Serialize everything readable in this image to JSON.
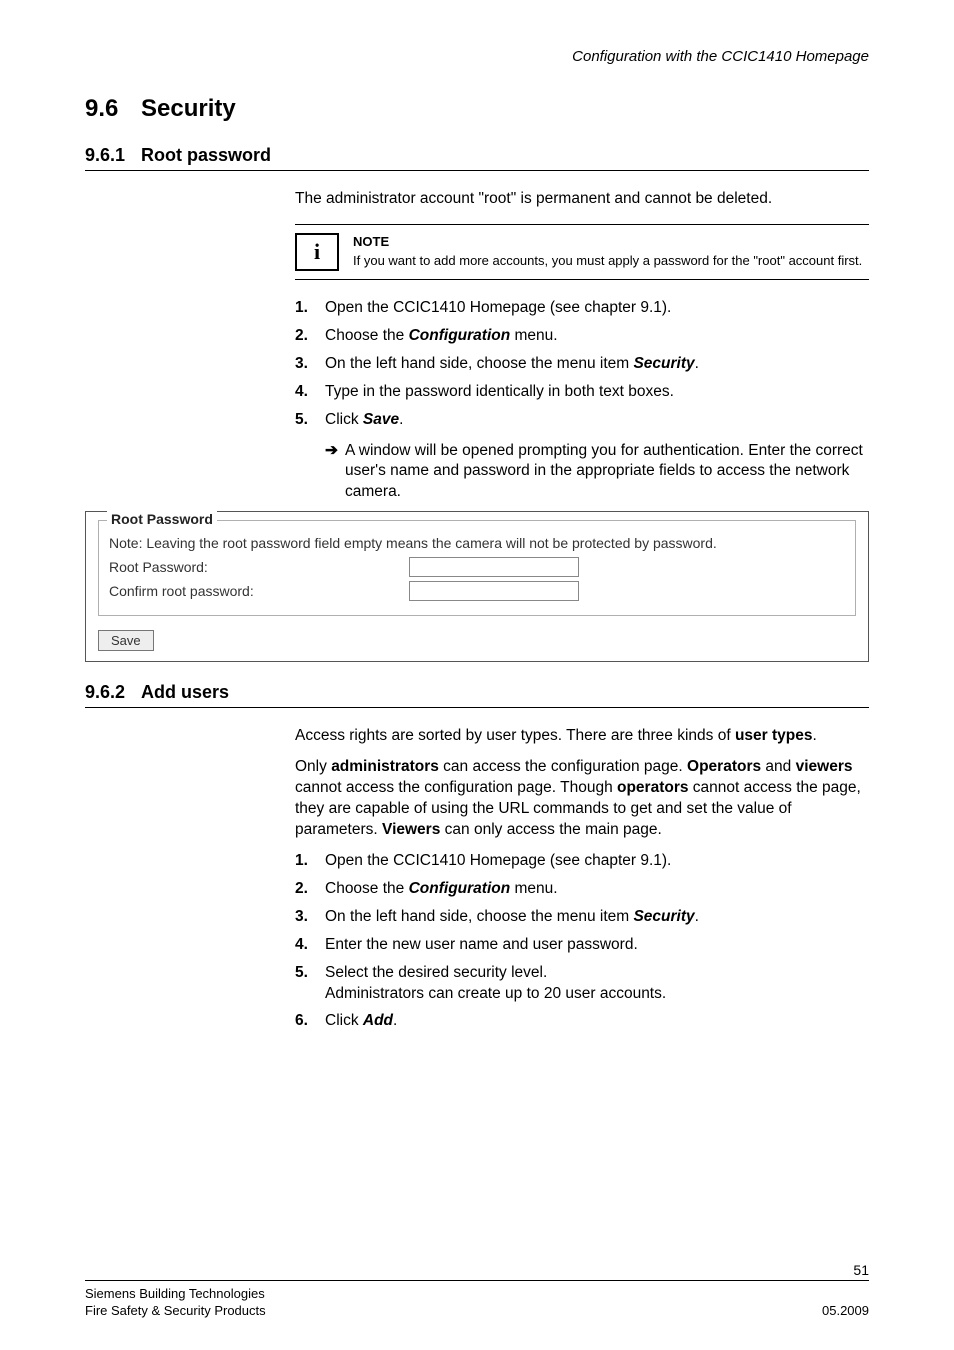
{
  "header": {
    "doc_section": "Configuration with the CCIC1410 Homepage"
  },
  "h1": {
    "num": "9.6",
    "title": "Security"
  },
  "section1": {
    "num": "9.6.1",
    "title": "Root password",
    "intro": "The administrator account \"root\" is permanent and cannot be deleted.",
    "note_title": "NOTE",
    "note_body": "If you want to add more accounts, you must apply a password for the \"root\" account first.",
    "steps": [
      {
        "n": "1.",
        "t": "Open the CCIC1410 Homepage (see chapter 9.1)."
      },
      {
        "n": "2.",
        "t_pre": "Choose the ",
        "t_em": "Configuration",
        "t_post": " menu."
      },
      {
        "n": "3.",
        "t_pre": "On the left hand side, choose the menu item ",
        "t_em": "Security",
        "t_post": "."
      },
      {
        "n": "4.",
        "t": "Type in the password identically in both text boxes."
      },
      {
        "n": "5.",
        "t_pre": "Click ",
        "t_em": "Save",
        "t_post": "."
      }
    ],
    "arrow": "A window will be opened prompting you for authentication. Enter the correct user's name and password in the appropriate fields to access the network camera.",
    "ui": {
      "legend": "Root Password",
      "note": "Note: Leaving the root password field empty means the camera will not be protected by password.",
      "label1": "Root Password:",
      "label2": "Confirm root password:",
      "save": "Save"
    }
  },
  "section2": {
    "num": "9.6.2",
    "title": "Add users",
    "para1_pre": "Access rights are sorted by user types. There are three kinds of ",
    "para1_b": "user types",
    "para1_post": ".",
    "para2_parts": {
      "a": "Only ",
      "b1": "administrators",
      "c": " can access the configuration page. ",
      "b2": "Operators",
      "d": " and ",
      "b3": "viewers",
      "e": " cannot access the configuration page. Though ",
      "b4": "operators",
      "f": " cannot access the page, they are capable of using the URL commands to get and set the value of parameters. ",
      "b5": "Viewers",
      "g": " can only access the main page."
    },
    "steps": [
      {
        "n": "1.",
        "t": "Open the CCIC1410 Homepage (see chapter 9.1)."
      },
      {
        "n": "2.",
        "t_pre": "Choose the ",
        "t_em": "Configuration",
        "t_post": " menu."
      },
      {
        "n": "3.",
        "t_pre": "On the left hand side, choose the menu item ",
        "t_em": "Security",
        "t_post": "."
      },
      {
        "n": "4.",
        "t": "Enter the new user name and user password."
      },
      {
        "n": "5.",
        "t": "Select the desired security level.",
        "t2": "Administrators can create up to 20 user accounts."
      },
      {
        "n": "6.",
        "t_pre": "Click ",
        "t_em": "Add",
        "t_post": "."
      }
    ]
  },
  "footer": {
    "page": "51",
    "left1": "Siemens Building Technologies",
    "left2": "Fire Safety & Security Products",
    "right": "05.2009"
  },
  "glyphs": {
    "info": "i",
    "arrow": "➔"
  }
}
